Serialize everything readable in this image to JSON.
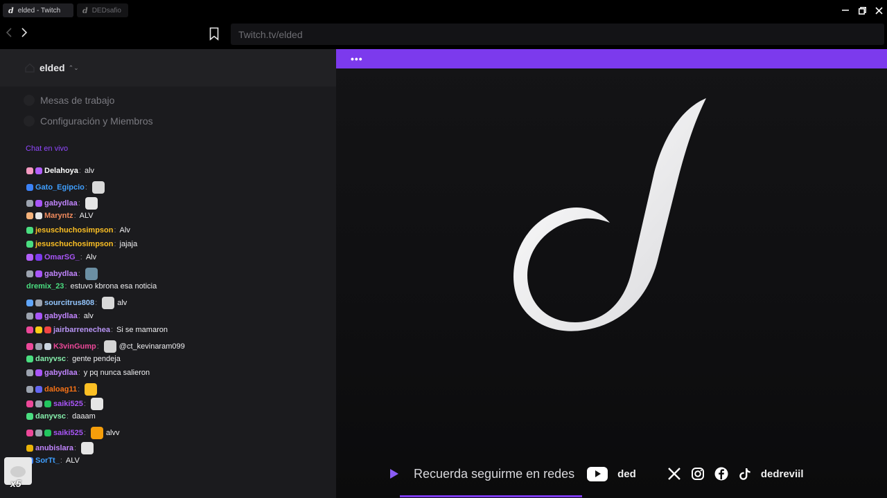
{
  "tabs": [
    {
      "title": "elded - Twitch"
    },
    {
      "title": "DEDsafio"
    }
  ],
  "nav": {
    "url": "Twitch.tv/elded"
  },
  "workspace": {
    "name": "elded"
  },
  "menu": [
    {
      "label": "Mesas de trabajo"
    },
    {
      "label": "Configuración y Miembros"
    }
  ],
  "chat": {
    "label": "Chat en vivo",
    "messages": [
      {
        "user": "Delahoya",
        "text": "alv",
        "color": "#ffffff",
        "badges": [
          "#f49ac1",
          "#b25ffb"
        ]
      },
      {
        "user": "Gato_Egipcio",
        "text": "",
        "color": "#3f9fff",
        "badges": [
          "#3b82f6"
        ],
        "emote": "#d9d9d9"
      },
      {
        "user": "gabydlaa",
        "text": "",
        "color": "#c084fc",
        "badges": [
          "#9ca3af",
          "#a855f7"
        ],
        "emote": "#e5e5e5"
      },
      {
        "user": "Maryntz",
        "text": "ALV",
        "color": "#f08a5d",
        "badges": [
          "#f5b27a",
          "#e5e5e5"
        ]
      },
      {
        "user": "jesuschuchosimpson",
        "text": "Alv",
        "color": "#fbbf24",
        "badges": [
          "#4ade80"
        ]
      },
      {
        "user": "jesuschuchosimpson",
        "text": "jajaja",
        "color": "#fbbf24",
        "badges": [
          "#4ade80"
        ]
      },
      {
        "user": "OmarSG_",
        "text": "Alv",
        "color": "#a855f7",
        "badges": [
          "#b25ffb",
          "#7c3aed"
        ]
      },
      {
        "user": "gabydlaa",
        "text": "",
        "color": "#c084fc",
        "badges": [
          "#9ca3af",
          "#a855f7"
        ],
        "emote": "#6b8fa3"
      },
      {
        "user": "dremix_23",
        "text": "estuvo kbrona esa noticia",
        "color": "#4ade80",
        "badges": []
      },
      {
        "user": "sourcitrus808",
        "text": "alv",
        "color": "#93c5fd",
        "badges": [
          "#60a5fa",
          "#9ca3af"
        ],
        "emote": "#d9d9d9"
      },
      {
        "user": "gabydlaa",
        "text": "alv",
        "color": "#c084fc",
        "badges": [
          "#9ca3af",
          "#a855f7"
        ]
      },
      {
        "user": "jairbarrenechea",
        "text": "Si se mamaron",
        "color": "#b794f4",
        "badges": [
          "#ec4899",
          "#facc15",
          "#ef4444"
        ]
      },
      {
        "user": "K3vinGump",
        "text": "@ct_kevinaram099",
        "color": "#ec4899",
        "badges": [
          "#ec4899",
          "#9ca3af",
          "#cbd5e1"
        ],
        "emote": "#d4d4d4"
      },
      {
        "user": "danyvsc",
        "text": "gente pendeja",
        "color": "#86efac",
        "badges": [
          "#4ade80"
        ]
      },
      {
        "user": "gabydlaa",
        "text": "y pq nunca salieron",
        "color": "#c084fc",
        "badges": [
          "#9ca3af",
          "#a855f7"
        ]
      },
      {
        "user": "daloag11",
        "text": "",
        "color": "#f97316",
        "badges": [
          "#9ca3af",
          "#6366f1"
        ],
        "emote": "#fbbf24"
      },
      {
        "user": "saiki525",
        "text": "",
        "color": "#a855f7",
        "badges": [
          "#ec4899",
          "#9ca3af",
          "#22c55e"
        ],
        "emote": "#e5e5e5"
      },
      {
        "user": "danyvsc",
        "text": "daaam",
        "color": "#86efac",
        "badges": [
          "#4ade80"
        ]
      },
      {
        "user": "saiki525",
        "text": "alvv",
        "color": "#a855f7",
        "badges": [
          "#ec4899",
          "#9ca3af",
          "#22c55e"
        ],
        "emote": "#f59e0b"
      },
      {
        "user": "anubislara",
        "text": "",
        "color": "#c084fc",
        "badges": [
          "#eab308"
        ],
        "emote": "#e5e5e5"
      },
      {
        "user": "SorTt_",
        "text": "ALV",
        "color": "#3f9fff",
        "badges": [
          "#3b82f6"
        ]
      }
    ]
  },
  "overlay": {
    "count": "x5"
  },
  "player": {
    "menu_label": "•••",
    "reminder": "Recuerda seguirme en redes",
    "youtube_name": "ded",
    "social_handle": "dedreviil"
  },
  "colors": {
    "accent": "#7c3aed",
    "link": "#9147ff"
  }
}
